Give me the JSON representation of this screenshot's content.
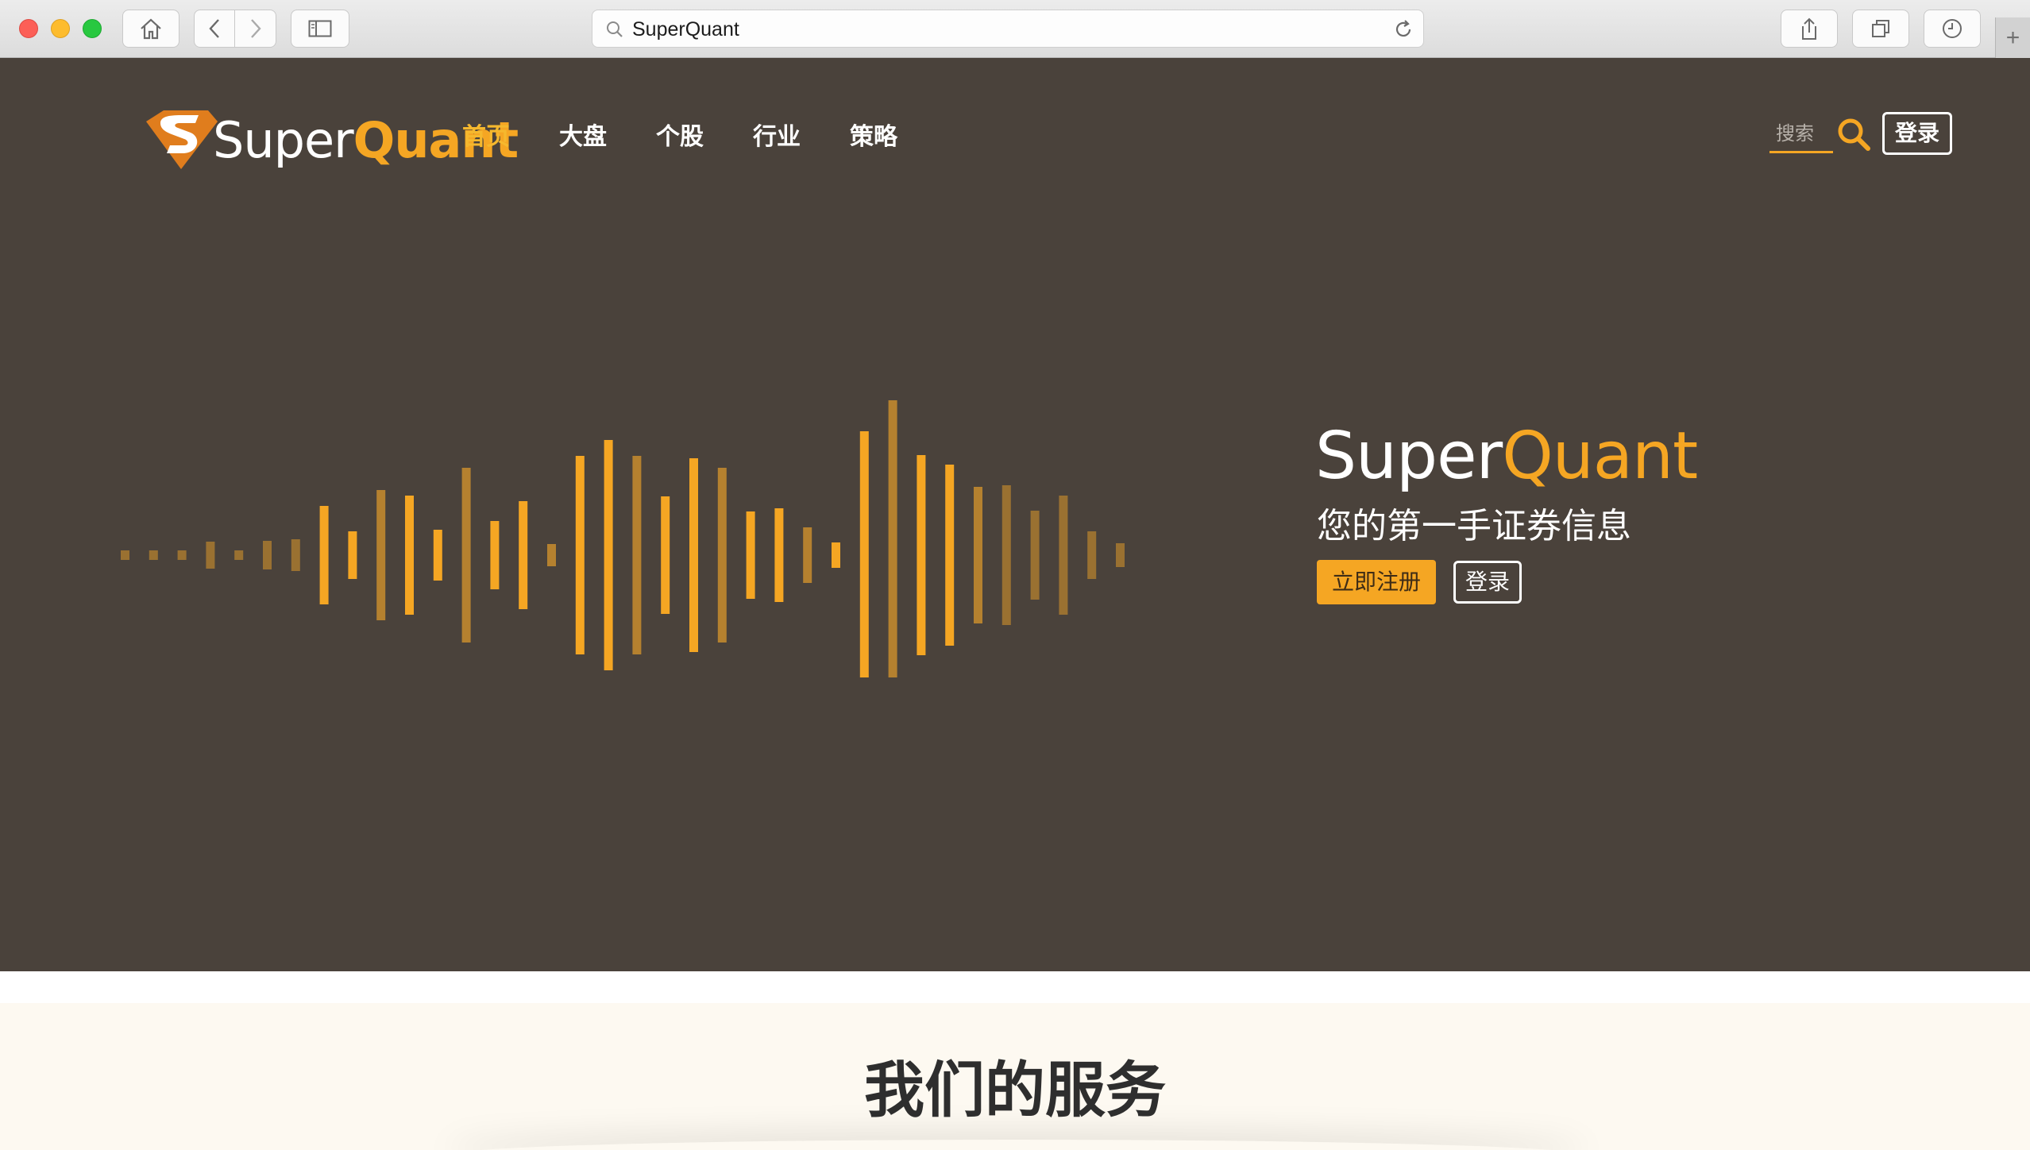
{
  "browser": {
    "url_text": "SuperQuant",
    "new_tab_symbol": "+",
    "icons": [
      "home-icon",
      "back-icon",
      "forward-icon",
      "sidebar-icon",
      "search-icon",
      "reload-icon",
      "share-icon",
      "tabs-icon",
      "history-icon"
    ]
  },
  "header": {
    "logo": {
      "part1": "Super",
      "part2": "Quant",
      "brand_color": "#f5a623"
    },
    "nav": [
      {
        "label": "首页",
        "active": true
      },
      {
        "label": "大盘",
        "active": false
      },
      {
        "label": "个股",
        "active": false
      },
      {
        "label": "行业",
        "active": false
      },
      {
        "label": "策略",
        "active": false
      }
    ],
    "search_placeholder": "搜索",
    "login_label": "登录"
  },
  "hero": {
    "title_part1": "Super",
    "title_part2": "Quant",
    "subtitle": "您的第一手证券信息",
    "register_label": "立即注册",
    "login_label": "登录",
    "background_color": "#4a423b",
    "accent_color": "#f5a623"
  },
  "services": {
    "title": "我们的服务"
  }
}
